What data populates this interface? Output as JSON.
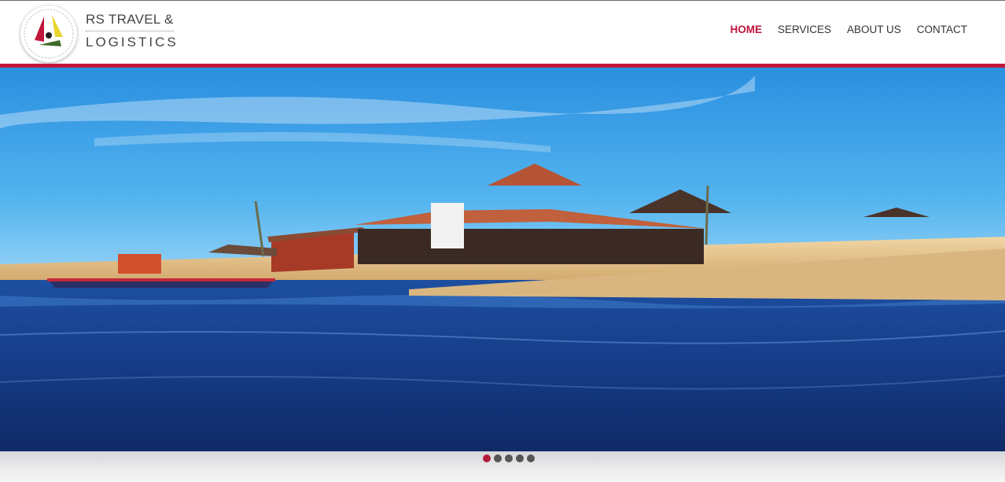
{
  "brand": {
    "line1": "RS TRAVEL &",
    "line2": "LOGISTICS"
  },
  "nav": {
    "home": "HOME",
    "services": "SERVICES",
    "about": "ABOUT US",
    "contact": "CONTACT"
  },
  "slider": {
    "total_slides": 5,
    "active_slide": 1
  },
  "colors": {
    "accent": "#c0163a",
    "sky": "#3aa6e8",
    "water": "#173d8a",
    "sand": "#e8c68d"
  }
}
